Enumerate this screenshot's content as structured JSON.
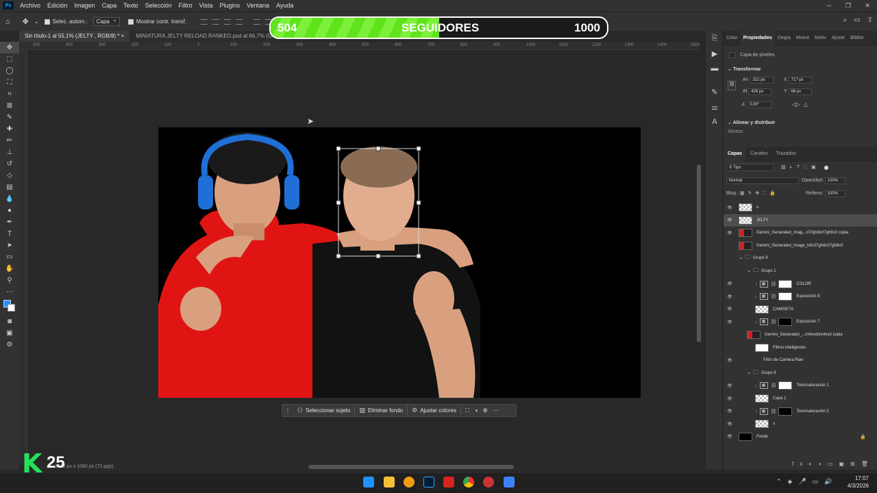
{
  "app": {
    "logo": "Ps",
    "menus": [
      "Archivo",
      "Edición",
      "Imagen",
      "Capa",
      "Texto",
      "Selección",
      "Filtro",
      "Vista",
      "Plugins",
      "Ventana",
      "Ayuda"
    ]
  },
  "options_bar": {
    "auto_select_label": "Selec. autom.:",
    "auto_select_value": "Capa",
    "show_transform_label": "Mostrar contr. transf."
  },
  "tabs": [
    {
      "label": "Sin título-1 al 55,1% (JELTY , RGB/8) *",
      "close": "×"
    },
    {
      "label": "MINIATURA JELTY RELOAD RANKED.psd al 66,7% (Gemini_G...",
      "close": "×"
    }
  ],
  "follower_bar": {
    "current": "504",
    "label": "SEGUIDORES",
    "goal": "1000",
    "progress_fraction": 0.5,
    "fill_color": "#5fe41c"
  },
  "ruler_ticks": [
    "500",
    "400",
    "300",
    "200",
    "100",
    "0",
    "100",
    "200",
    "300",
    "400",
    "500",
    "600",
    "700",
    "800",
    "900",
    "1000",
    "1100",
    "1200",
    "1300",
    "1400",
    "1500"
  ],
  "status": {
    "doc_info": "1928 px x 1080 px (72 ppp)"
  },
  "context_bar": {
    "select_subject": "Seleccionar sujeto",
    "remove_bg": "Eliminar fondo",
    "adjust_colors": "Ajustar colores"
  },
  "watermark": {
    "letter": "K",
    "number": "25"
  },
  "properties": {
    "tabs": [
      "Color",
      "Propiedades",
      "Degra",
      "Muest",
      "Motiv",
      "Ajuste",
      "Bibliot"
    ],
    "active_tab": "Propiedades",
    "pixel_layer": "Capa de píxeles",
    "transform_title": "Transformar",
    "w_label": "An",
    "w_value": "321 px",
    "h_label": "Al",
    "h_value": "428 px",
    "x_label": "X",
    "x_value": "717 px",
    "y_label": "Y",
    "y_value": "86 px",
    "angle_value": "0,00°",
    "align_title": "Alinear y distribuir",
    "align_label": "Alinear:"
  },
  "layers_panel": {
    "tabs": [
      "Capas",
      "Canales",
      "Trazados"
    ],
    "filter_value": "Tipo",
    "blend_mode": "Normal",
    "opacity_label": "Opacidad:",
    "opacity_value": "100%",
    "lock_label": "Bloq.:",
    "fill_label": "Relleno:",
    "fill_value": "100%",
    "layers": [
      {
        "name": "s",
        "thumb": "checker",
        "visible": true,
        "indent": 0
      },
      {
        "name": "JELTY",
        "thumb": "checker",
        "visible": true,
        "indent": 0,
        "selected": true
      },
      {
        "name": "Gemini_Generated_Imag...c07gh8c07gh8c0 copia",
        "thumb": "photo",
        "visible": true,
        "indent": 0
      },
      {
        "name": "Gemini_Generated_Image_h8c07gh8c07gh8c0",
        "thumb": "photo",
        "visible": false,
        "indent": 0
      },
      {
        "name": "Grupo 9",
        "thumb": "folder",
        "visible": false,
        "indent": 0
      },
      {
        "name": "Grupo 1",
        "thumb": "folder",
        "visible": false,
        "indent": 1
      },
      {
        "name": "COLOR",
        "thumb": "white",
        "visible": true,
        "indent": 2,
        "adj": true
      },
      {
        "name": "Exposición 8",
        "thumb": "white",
        "visible": true,
        "indent": 2,
        "adj": true
      },
      {
        "name": "CAMISETA",
        "thumb": "checker",
        "visible": true,
        "indent": 2
      },
      {
        "name": "Exposición 7",
        "thumb": "black",
        "visible": true,
        "indent": 2,
        "adj": true
      },
      {
        "name": "Gemini_Generated_...m4xvdnm4xvd copia",
        "thumb": "photo",
        "visible": false,
        "indent": 1
      },
      {
        "name": "Filtros inteligentes",
        "thumb": "white",
        "visible": false,
        "indent": 2
      },
      {
        "name": "Filtro de Camera Raw",
        "thumb": "none",
        "visible": true,
        "indent": 3
      },
      {
        "name": "Grupo 8",
        "thumb": "folder",
        "visible": false,
        "indent": 1
      },
      {
        "name": "Tono/saturación 1",
        "thumb": "white",
        "visible": true,
        "indent": 2,
        "adj": true
      },
      {
        "name": "Capa 1",
        "thumb": "checker",
        "visible": true,
        "indent": 2
      },
      {
        "name": "Tono/saturación 2",
        "thumb": "black",
        "visible": true,
        "indent": 2,
        "adj": true
      },
      {
        "name": "s",
        "thumb": "checker",
        "visible": true,
        "indent": 2
      },
      {
        "name": "Fondo",
        "thumb": "black",
        "visible": true,
        "indent": 0,
        "locked": true
      }
    ]
  },
  "taskbar": {
    "time": "17:07",
    "date": "4/3/2026"
  }
}
